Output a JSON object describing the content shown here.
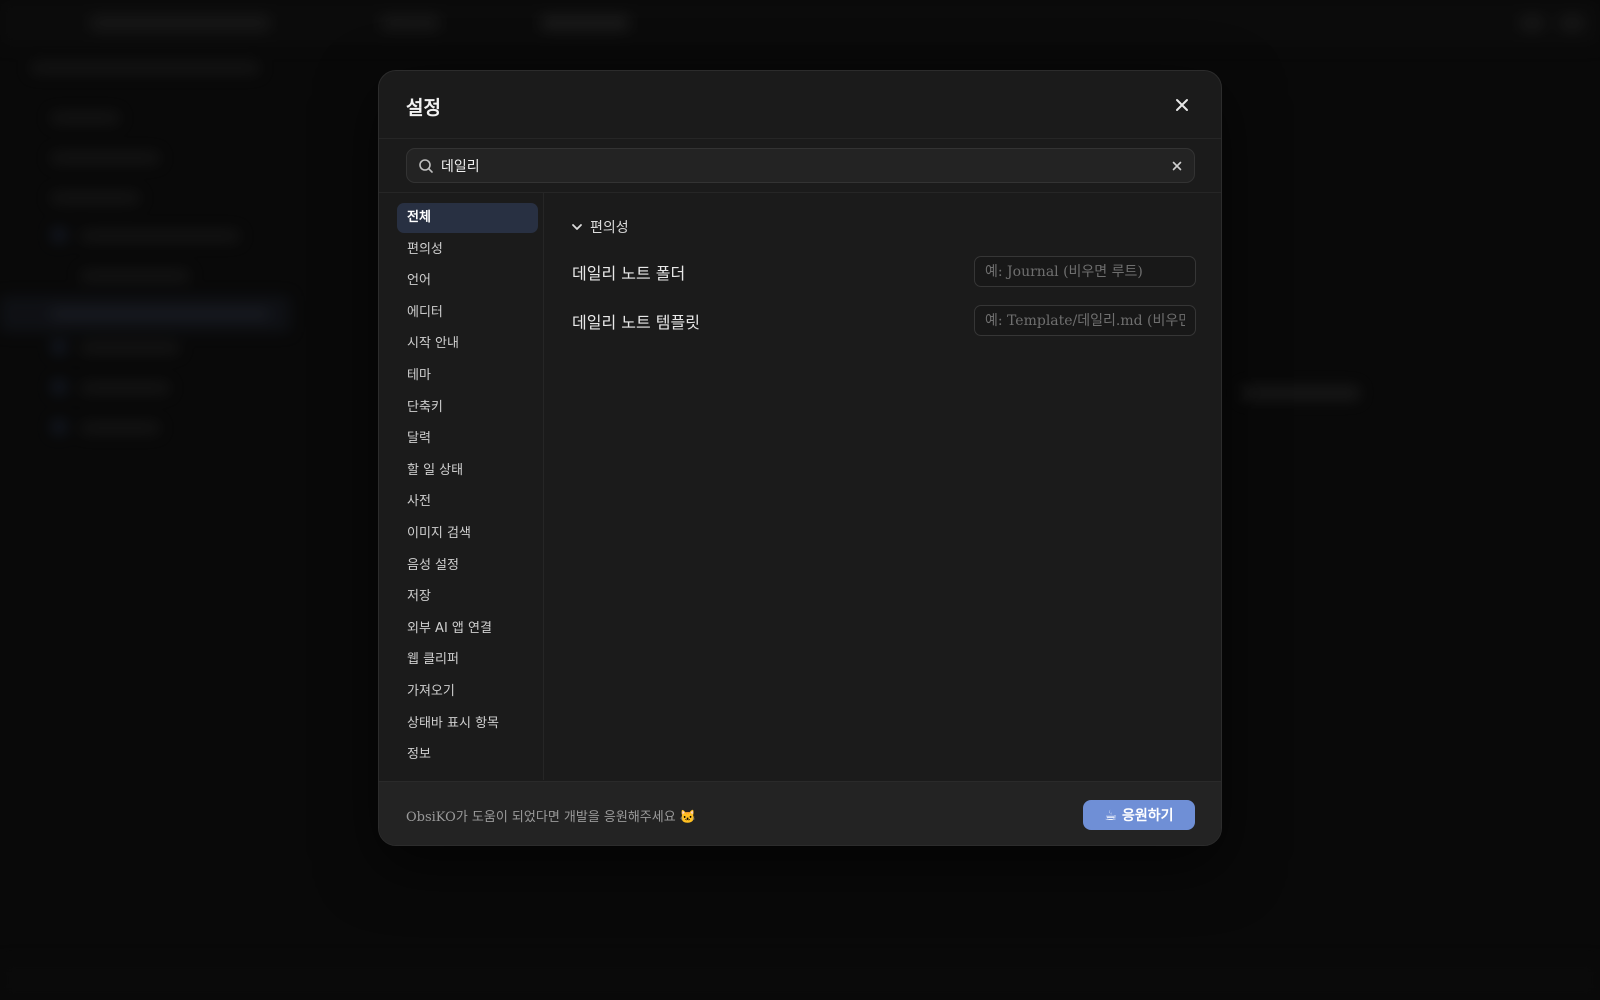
{
  "dialog": {
    "title": "설정",
    "close_icon": "close-icon"
  },
  "search": {
    "value": "데일리",
    "icon": "search-icon",
    "clear_icon": "clear-icon"
  },
  "nav": {
    "items": [
      {
        "label": "전체",
        "active": true
      },
      {
        "label": "편의성"
      },
      {
        "label": "언어"
      },
      {
        "label": "에디터"
      },
      {
        "label": "시작 안내"
      },
      {
        "label": "테마"
      },
      {
        "label": "단축키"
      },
      {
        "label": "달력"
      },
      {
        "label": "할 일 상태"
      },
      {
        "label": "사전"
      },
      {
        "label": "이미지 검색"
      },
      {
        "label": "음성 설정"
      },
      {
        "label": "저장"
      },
      {
        "label": "외부 AI 앱 연결"
      },
      {
        "label": "웹 클리퍼"
      },
      {
        "label": "가져오기"
      },
      {
        "label": "상태바 표시 항목"
      },
      {
        "label": "정보"
      }
    ]
  },
  "section": {
    "title": "편의성",
    "chevron_icon": "chevron-down-icon",
    "settings": [
      {
        "label": "데일리 노트 폴더",
        "placeholder": "예: Journal (비우면 루트)"
      },
      {
        "label": "데일리 노트 템플릿",
        "placeholder": "예: Template/데일리.md (비우면 기본)"
      }
    ]
  },
  "footer": {
    "message": "ObsiKO가 도움이 되었다면 개발을 응원해주세요 🐱",
    "support_label": "☕ 응원하기",
    "accent_color": "#6f8fd6"
  }
}
